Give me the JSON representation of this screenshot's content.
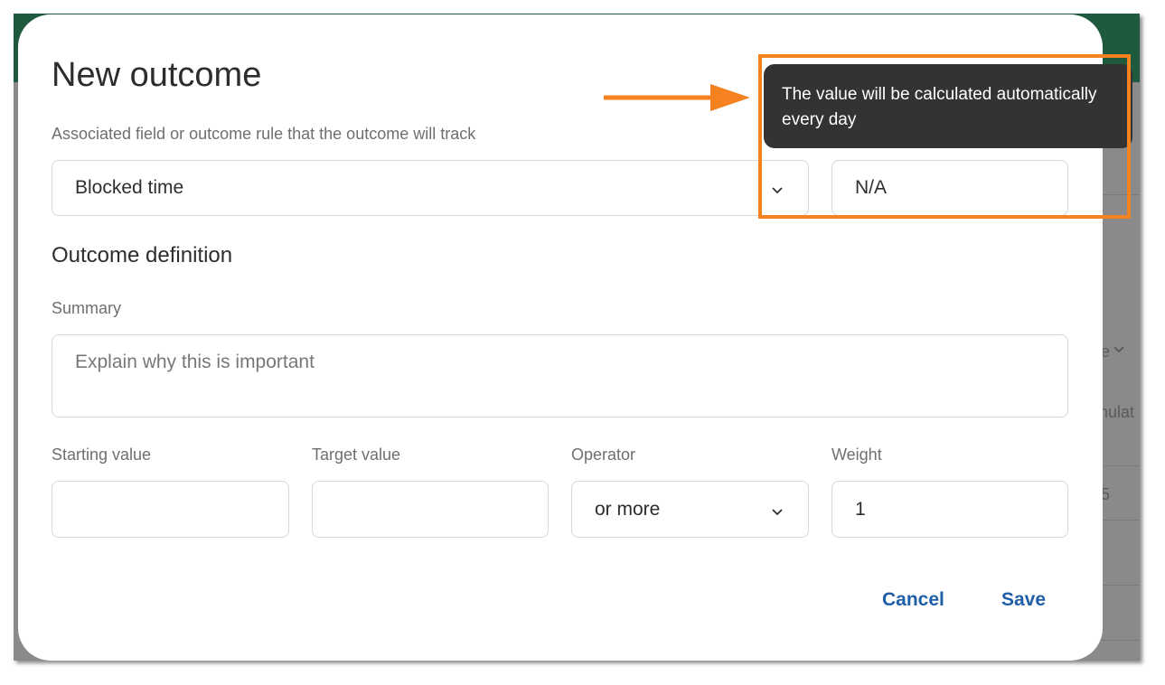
{
  "background": {
    "partial_texts": [
      "e",
      "nulat",
      "5"
    ]
  },
  "dialog": {
    "title": "New outcome",
    "associated_label": "Associated field or outcome rule that the outcome will track",
    "associated_value": "Blocked time",
    "current_value": "N/A",
    "definition_heading": "Outcome definition",
    "summary_label": "Summary",
    "summary_placeholder": "Explain why this is important",
    "starting_label": "Starting value",
    "starting_value": "",
    "target_label": "Target value",
    "target_value": "",
    "operator_label": "Operator",
    "operator_value": "or more",
    "weight_label": "Weight",
    "weight_value": "1",
    "cancel_label": "Cancel",
    "save_label": "Save"
  },
  "tooltip": {
    "text": "The value will be calculated automatically every day"
  },
  "annotation": {
    "color": "#f58220"
  }
}
